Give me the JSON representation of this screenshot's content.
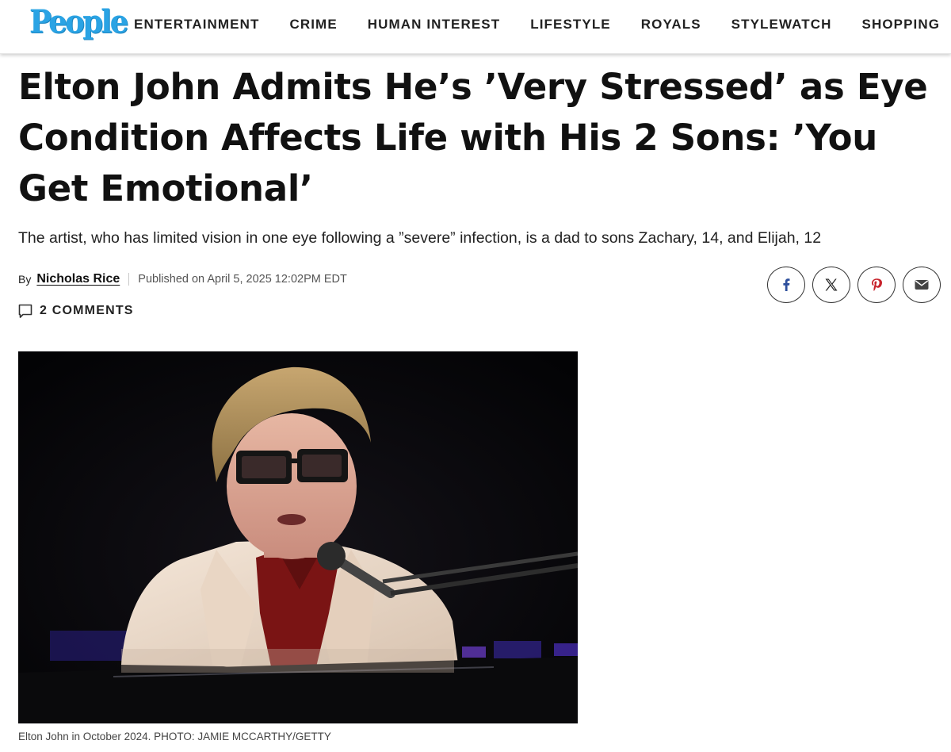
{
  "site": {
    "logo_text": "People",
    "brand_color": "#2aa3e4"
  },
  "nav": {
    "items": [
      {
        "label": "ENTERTAINMENT"
      },
      {
        "label": "CRIME"
      },
      {
        "label": "HUMAN INTEREST"
      },
      {
        "label": "LIFESTYLE"
      },
      {
        "label": "ROYALS"
      },
      {
        "label": "STYLEWATCH"
      },
      {
        "label": "SHOPPING"
      }
    ]
  },
  "article": {
    "headline": "Elton John Admits He’s ’Very Stressed’ as Eye Condition Affects Life with His 2 Sons: ’You Get Emotional’",
    "subhead": "The artist, who has limited vision in one eye following a ”severe” infection, is a dad to sons Zachary, 14, and Elijah, 12",
    "byline_prefix": "By",
    "author": "Nicholas Rice",
    "published": "Published on April 5, 2025 12:02PM EDT",
    "comments_label": "2 COMMENTS",
    "caption": "Elton John in October 2024. PHOTO:  JAMIE MCCARTHY/GETTY"
  },
  "share": {
    "buttons": [
      {
        "icon": "facebook-icon",
        "glyph": "f",
        "color": "#2d4f9c"
      },
      {
        "icon": "x-icon",
        "glyph": "𝕏",
        "color": "#222222"
      },
      {
        "icon": "pinterest-icon",
        "glyph": "P",
        "color": "#c8232c"
      },
      {
        "icon": "email-icon",
        "glyph": "✉",
        "color": "#444444"
      }
    ]
  }
}
